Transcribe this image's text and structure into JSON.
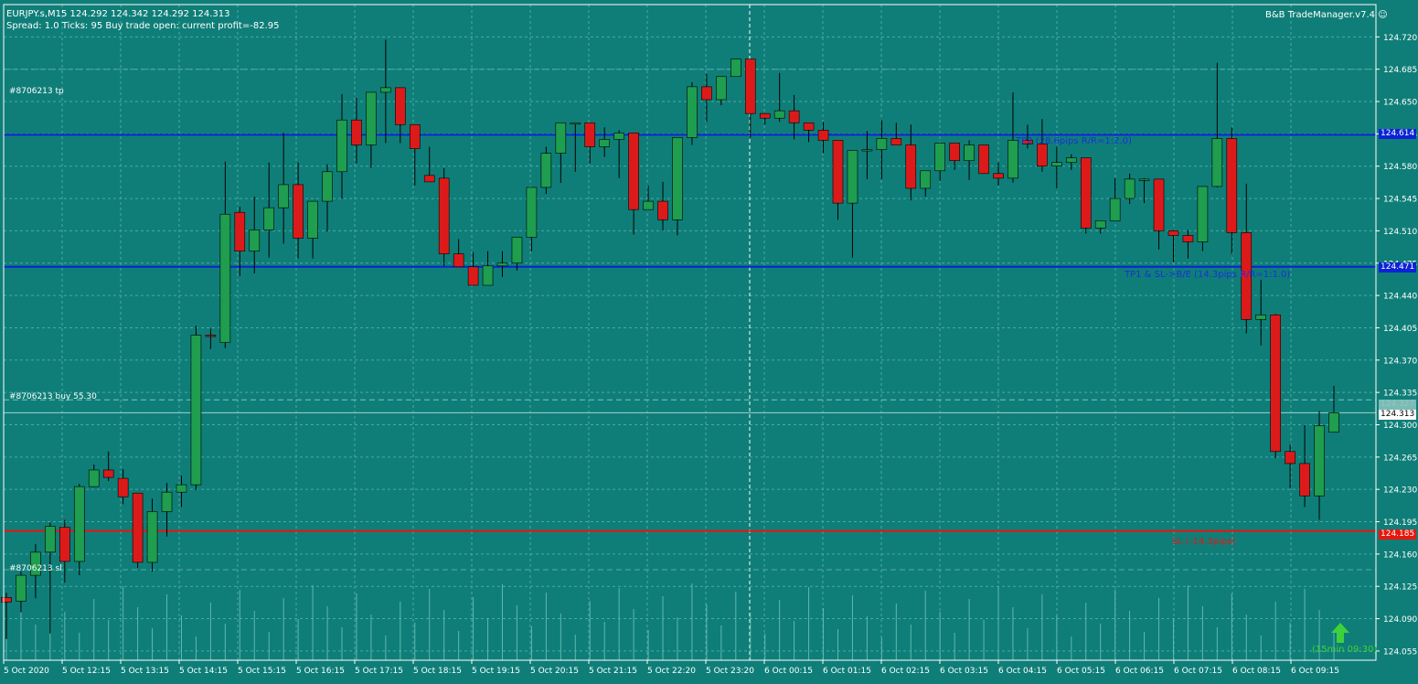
{
  "header": {
    "symbol_line": "EURJPY.s,M15  124.292 124.342 124.292 124.313",
    "info_line": "Spread: 1.0  Ticks: 95  Buy trade open: current profit=-82.95",
    "manager": "B&B TradeManager.v7.4",
    "manager_icon": "smiley-icon"
  },
  "order_labels": {
    "tp": "#8706213 tp",
    "buy": "#8706213 buy 55.30",
    "sl": "#8706213 sl"
  },
  "levels": {
    "tp2_text": "TP2 (28.6pips R/R=1:2.0)",
    "tp1_text": "TP1 & SL->B/E (14.3pips R/R=1:1.0)",
    "sl_text": "SL (-14.3pips)",
    "tp2_tag": "124.614",
    "tp1_tag": "124.471",
    "sl_tag": "124.185",
    "bid_tag": "124.313",
    "buy_tag": "124.327"
  },
  "timer_text": "(15min 09:30)",
  "timer_icon": "arrow-up-icon",
  "colors": {
    "background": "#0f7e78",
    "bull": "#1e9e4e",
    "bear": "#dd1a1a",
    "tp_line": "#0c22d6",
    "sl_line": "#e8160e",
    "grid": "#4aa9a3",
    "tp_text": "#1a2fe0",
    "sl_text": "#e8160e",
    "timer": "#3ed13a"
  },
  "chart_data": {
    "type": "candlestick",
    "symbol": "EURJPY.s",
    "timeframe": "M15",
    "ylim": [
      124.045,
      124.755
    ],
    "y_ticks": [
      124.72,
      124.685,
      124.65,
      124.615,
      124.58,
      124.545,
      124.51,
      124.475,
      124.44,
      124.405,
      124.37,
      124.335,
      124.3,
      124.265,
      124.23,
      124.195,
      124.16,
      124.125,
      124.09,
      124.055
    ],
    "y_tick_labels": [
      "124.720",
      "124.685",
      "124.650",
      "124.615",
      "124.580",
      "124.545",
      "124.510",
      "124.475",
      "124.440",
      "124.405",
      "124.370",
      "124.335",
      "124.300",
      "124.265",
      "124.230",
      "124.195",
      "124.160",
      "124.125",
      "124.090",
      "124.055"
    ],
    "x_tick_labels": [
      "5 Oct 2020",
      "5 Oct 12:15",
      "5 Oct 13:15",
      "5 Oct 14:15",
      "5 Oct 15:15",
      "5 Oct 16:15",
      "5 Oct 17:15",
      "5 Oct 18:15",
      "5 Oct 19:15",
      "5 Oct 20:15",
      "5 Oct 21:15",
      "5 Oct 22:20",
      "5 Oct 23:20",
      "6 Oct 00:15",
      "6 Oct 01:15",
      "6 Oct 02:15",
      "6 Oct 03:15",
      "6 Oct 04:15",
      "6 Oct 05:15",
      "6 Oct 06:15",
      "6 Oct 07:15",
      "6 Oct 08:15",
      "6 Oct 09:15"
    ],
    "candles": [
      [
        124.113,
        124.118,
        124.068,
        124.108
      ],
      [
        124.109,
        124.141,
        124.097,
        124.137
      ],
      [
        124.137,
        124.171,
        124.112,
        124.162
      ],
      [
        124.162,
        124.194,
        124.074,
        124.19
      ],
      [
        124.189,
        124.197,
        124.129,
        124.152
      ],
      [
        124.152,
        124.236,
        124.137,
        124.233
      ],
      [
        124.233,
        124.257,
        124.236,
        124.251
      ],
      [
        124.251,
        124.271,
        124.239,
        124.243
      ],
      [
        124.242,
        124.252,
        124.214,
        124.222
      ],
      [
        124.226,
        124.222,
        124.145,
        124.151
      ],
      [
        124.151,
        124.22,
        124.141,
        124.206
      ],
      [
        124.206,
        124.237,
        124.179,
        124.227
      ],
      [
        124.227,
        124.245,
        124.211,
        124.235
      ],
      [
        124.235,
        124.407,
        124.229,
        124.397
      ],
      [
        124.397,
        124.404,
        124.382,
        124.396
      ],
      [
        124.389,
        124.585,
        124.383,
        124.528
      ],
      [
        124.53,
        124.536,
        124.461,
        124.488
      ],
      [
        124.488,
        124.547,
        124.464,
        124.511
      ],
      [
        124.511,
        124.584,
        124.481,
        124.535
      ],
      [
        124.535,
        124.616,
        124.496,
        124.56
      ],
      [
        124.56,
        124.584,
        124.48,
        124.502
      ],
      [
        124.502,
        124.54,
        124.48,
        124.542
      ],
      [
        124.542,
        124.582,
        124.509,
        124.574
      ],
      [
        124.574,
        124.658,
        124.545,
        124.63
      ],
      [
        124.63,
        124.654,
        124.583,
        124.603
      ],
      [
        124.603,
        124.655,
        124.578,
        124.66
      ],
      [
        124.66,
        124.717,
        124.605,
        124.665
      ],
      [
        124.665,
        124.638,
        124.605,
        124.625
      ],
      [
        124.625,
        124.606,
        124.559,
        124.599
      ],
      [
        124.57,
        124.601,
        124.571,
        124.563
      ],
      [
        124.567,
        124.578,
        124.472,
        124.485
      ],
      [
        124.485,
        124.501,
        124.475,
        124.471
      ],
      [
        124.471,
        124.487,
        124.455,
        124.451
      ],
      [
        124.451,
        124.488,
        124.46,
        124.472
      ],
      [
        124.472,
        124.488,
        124.46,
        124.475
      ],
      [
        124.475,
        124.496,
        124.467,
        124.503
      ],
      [
        124.503,
        124.522,
        124.488,
        124.557
      ],
      [
        124.557,
        124.601,
        124.55,
        124.594
      ],
      [
        124.594,
        124.627,
        124.562,
        124.627
      ],
      [
        124.627,
        124.627,
        124.574,
        124.627
      ],
      [
        124.627,
        124.627,
        124.583,
        124.601
      ],
      [
        124.601,
        124.622,
        124.59,
        124.609
      ],
      [
        124.609,
        124.619,
        124.567,
        124.616
      ],
      [
        124.616,
        124.582,
        124.506,
        124.533
      ],
      [
        124.533,
        124.559,
        124.544,
        124.542
      ],
      [
        124.542,
        124.563,
        124.51,
        124.522
      ],
      [
        124.522,
        124.607,
        124.505,
        124.611
      ],
      [
        124.611,
        124.671,
        124.603,
        124.666
      ],
      [
        124.666,
        124.68,
        124.628,
        124.652
      ],
      [
        124.652,
        124.677,
        124.646,
        124.677
      ],
      [
        124.677,
        124.692,
        124.681,
        124.696
      ],
      [
        124.696,
        124.671,
        124.611,
        124.637
      ],
      [
        124.637,
        124.629,
        124.625,
        124.632
      ],
      [
        124.632,
        124.681,
        124.628,
        124.64
      ],
      [
        124.64,
        124.657,
        124.609,
        124.627
      ],
      [
        124.627,
        124.611,
        124.606,
        124.619
      ],
      [
        124.619,
        124.628,
        124.594,
        124.608
      ],
      [
        124.608,
        124.577,
        124.522,
        124.54
      ],
      [
        124.54,
        124.59,
        124.481,
        124.597
      ],
      [
        124.597,
        124.618,
        124.566,
        124.598
      ],
      [
        124.598,
        124.63,
        124.566,
        124.61
      ],
      [
        124.61,
        124.627,
        124.617,
        124.603
      ],
      [
        124.603,
        124.625,
        124.543,
        124.556
      ],
      [
        124.556,
        124.574,
        124.547,
        124.575
      ],
      [
        124.575,
        124.602,
        124.564,
        124.605
      ],
      [
        124.605,
        124.603,
        124.576,
        124.586
      ],
      [
        124.586,
        124.608,
        124.565,
        124.603
      ],
      [
        124.603,
        124.603,
        124.578,
        124.572
      ],
      [
        124.572,
        124.584,
        124.559,
        124.567
      ],
      [
        124.567,
        124.66,
        124.562,
        124.608
      ],
      [
        124.608,
        124.625,
        124.599,
        124.604
      ],
      [
        124.604,
        124.631,
        124.574,
        124.58
      ],
      [
        124.58,
        124.601,
        124.556,
        124.584
      ],
      [
        124.584,
        124.593,
        124.576,
        124.589
      ],
      [
        124.589,
        124.585,
        124.507,
        124.513
      ],
      [
        124.513,
        124.52,
        124.507,
        124.521
      ],
      [
        124.521,
        124.567,
        124.529,
        124.545
      ],
      [
        124.545,
        124.572,
        124.539,
        124.566
      ],
      [
        124.566,
        124.567,
        124.54,
        124.566
      ],
      [
        124.566,
        124.55,
        124.49,
        124.51
      ],
      [
        124.51,
        124.511,
        124.476,
        124.505
      ],
      [
        124.505,
        124.511,
        124.48,
        124.498
      ],
      [
        124.498,
        124.555,
        124.488,
        124.558
      ],
      [
        124.558,
        124.692,
        124.557,
        124.61
      ],
      [
        124.61,
        124.622,
        124.485,
        124.508
      ],
      [
        124.508,
        124.561,
        124.399,
        124.414
      ],
      [
        124.414,
        124.457,
        124.386,
        124.419
      ],
      [
        124.419,
        124.42,
        124.264,
        124.271
      ],
      [
        124.271,
        124.279,
        124.231,
        124.258
      ],
      [
        124.258,
        124.3,
        124.211,
        124.223
      ],
      [
        124.223,
        124.315,
        124.197,
        124.299
      ],
      [
        124.292,
        124.342,
        124.292,
        124.313
      ]
    ]
  }
}
